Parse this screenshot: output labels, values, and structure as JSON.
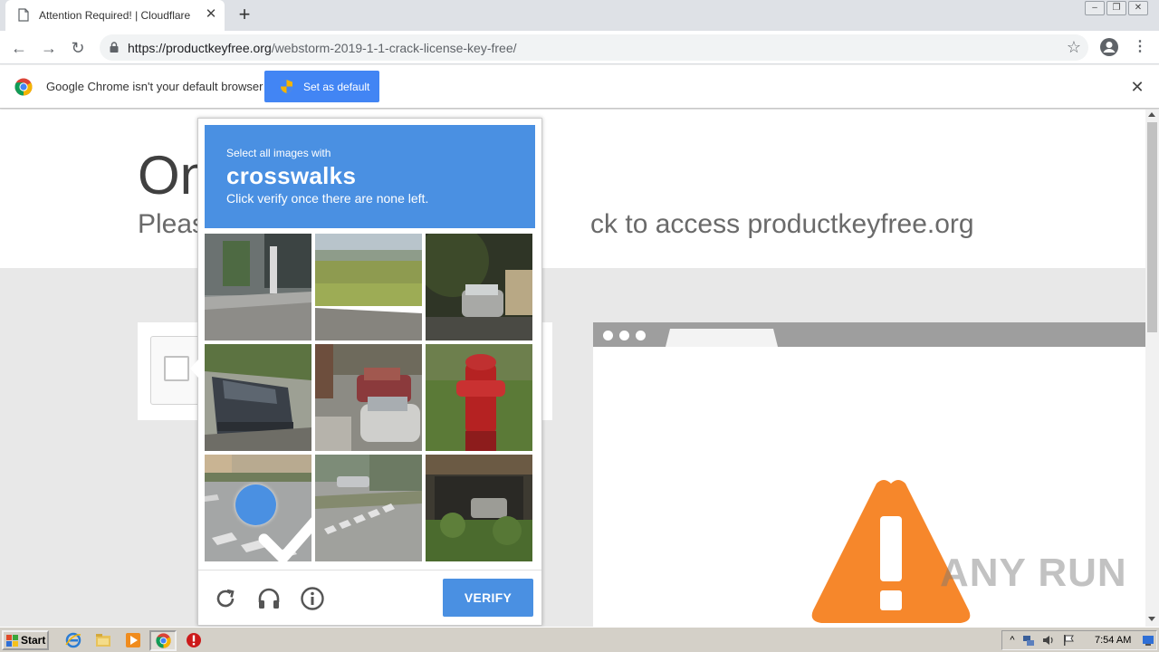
{
  "browser": {
    "tab_title": "Attention Required! | Cloudflare",
    "url_host": "https://productkeyfree.org",
    "url_path": "/webstorm-2019-1-1-crack-license-key-free/"
  },
  "infobar": {
    "message": "Google Chrome isn't your default browser",
    "button_label": "Set as default"
  },
  "page": {
    "heading_partial": "On",
    "subheading_left": "Pleas",
    "subheading_right": "ck to access productkeyfree.org"
  },
  "challenge": {
    "line1": "Select all images with",
    "keyword": "crosswalks",
    "line3": "Click verify once there are none left.",
    "verify_label": "VERIFY",
    "tiles": [
      {
        "desc": "building-sidewalk",
        "selected": false
      },
      {
        "desc": "grass-field",
        "selected": false
      },
      {
        "desc": "parked-car-dark",
        "selected": false
      },
      {
        "desc": "sedan-shadow",
        "selected": false
      },
      {
        "desc": "cars-street",
        "selected": false
      },
      {
        "desc": "fire-hydrant",
        "selected": false
      },
      {
        "desc": "crosswalk-1",
        "selected": true
      },
      {
        "desc": "crosswalk-2",
        "selected": false
      },
      {
        "desc": "garage-car",
        "selected": false
      }
    ]
  },
  "watermark": "ANY RUN",
  "taskbar": {
    "start_label": "Start",
    "time": "7:54 AM"
  },
  "colors": {
    "challenge_blue": "#4a90e2",
    "chrome_blue": "#4285f4",
    "warning_orange": "#f6872b"
  }
}
